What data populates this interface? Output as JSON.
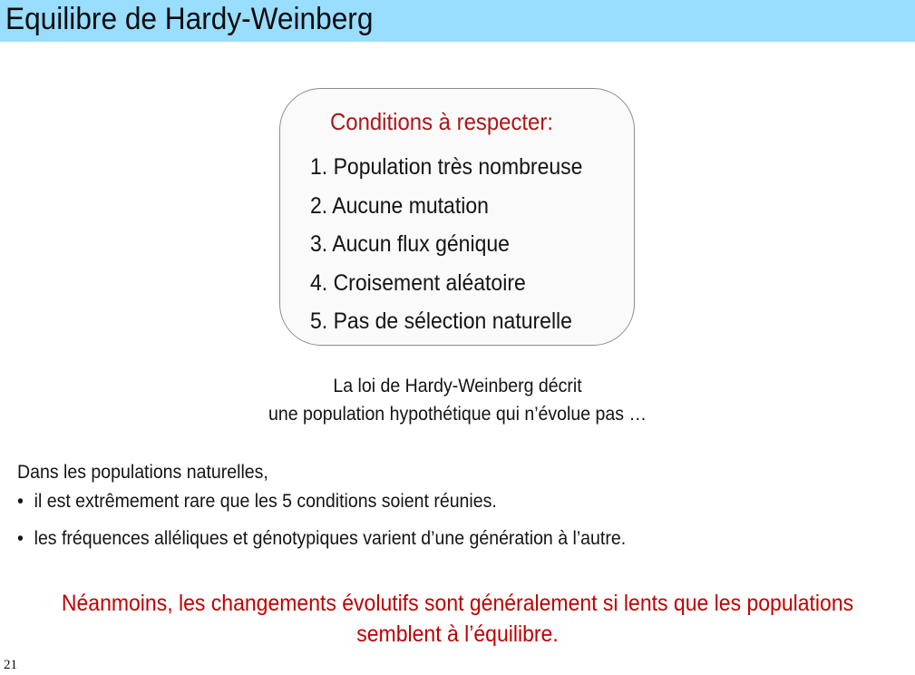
{
  "slide": {
    "title": "Equilibre de Hardy-Weinberg",
    "number": "21"
  },
  "conditions": {
    "heading": "Conditions à respecter:",
    "items": [
      "1. Population très nombreuse",
      "2. Aucune mutation",
      "3. Aucun flux génique",
      "4. Croisement aléatoire",
      "5. Pas de sélection naturelle"
    ]
  },
  "statement": {
    "line1": "La loi de Hardy-Weinberg décrit",
    "line2": "une population hypothétique qui n’évolue pas …"
  },
  "natural": {
    "intro": "Dans les populations naturelles,",
    "bullet_symbol": "•",
    "bullets": [
      "il est extrêmement rare que les 5 conditions soient réunies.",
      "les fréquences alléliques et génotypiques varient d’une génération à l’autre."
    ]
  },
  "conclusion": {
    "line1": "Néanmoins, les changements évolutifs sont généralement si lents que les populations",
    "line2": "semblent à l’équilibre."
  },
  "colors": {
    "title_bar": "#99ddff",
    "accent_red": "#c00000",
    "box_border": "#8c8c8c"
  }
}
